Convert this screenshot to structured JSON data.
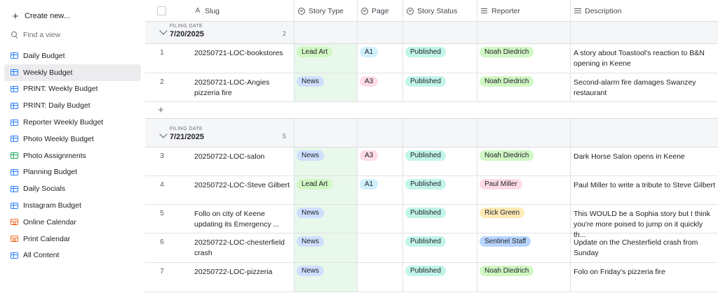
{
  "sidebar": {
    "create_label": "Create new...",
    "find_placeholder": "Find a view",
    "items": [
      {
        "label": "Daily Budget",
        "icon": "grid-view-icon",
        "active": false
      },
      {
        "label": "Weekly Budget",
        "icon": "grid-view-icon",
        "active": true
      },
      {
        "label": "PRINT: Weekly Budget",
        "icon": "grid-view-icon",
        "active": false
      },
      {
        "label": "PRINT: Daily Budget",
        "icon": "grid-view-icon",
        "active": false
      },
      {
        "label": "Reporter Weekly Budget",
        "icon": "grid-view-icon",
        "active": false
      },
      {
        "label": "Photo Weekly Budget",
        "icon": "grid-view-icon",
        "active": false
      },
      {
        "label": "Photo Assignments",
        "icon": "kanban-view-icon",
        "active": false
      },
      {
        "label": "Planning Budget",
        "icon": "grid-view-icon",
        "active": false
      },
      {
        "label": "Daily Socials",
        "icon": "grid-view-icon",
        "active": false
      },
      {
        "label": "Instagram Budget",
        "icon": "grid-view-icon",
        "active": false
      },
      {
        "label": "Online Calendar",
        "icon": "calendar-view-icon",
        "active": false
      },
      {
        "label": "Print Calendar",
        "icon": "calendar-view-icon",
        "active": false
      },
      {
        "label": "All Content",
        "icon": "grid-view-icon",
        "active": false
      }
    ]
  },
  "columns": {
    "slug": "Slug",
    "story_type": "Story Type",
    "page": "Page",
    "story_status": "Story Status",
    "reporter": "Reporter",
    "description": "Description"
  },
  "colors": {
    "lead_art": "#d1f7c4",
    "news": "#cfdfff",
    "page_a1": "#d0f0fd",
    "page_a3": "#ffdce5",
    "published": "#c2f5e9",
    "reporter_green": "#d1f7c4",
    "reporter_pink": "#ffdce5",
    "reporter_yellow": "#ffeab6",
    "reporter_blue": "#b8d5ff",
    "story_type_column_bg": "#e8f8ea"
  },
  "groups": [
    {
      "label": "FILING DATE",
      "value": "7/20/2025",
      "count": "2",
      "rows": [
        {
          "num": "1",
          "slug": "20250721-LOC-bookstores",
          "story_type": "Lead Art",
          "page": "A1",
          "status": "Published",
          "reporter": "Noah Diedrich",
          "description": "A story about Toastool's reaction to B&N opening in Keene"
        },
        {
          "num": "2",
          "slug": "20250721-LOC-Angies pizzeria fire",
          "story_type": "News",
          "page": "A3",
          "status": "Published",
          "reporter": "Noah Diedrich",
          "description": "Second-alarm fire damages Swanzey restaurant"
        }
      ]
    },
    {
      "label": "FILING DATE",
      "value": "7/21/2025",
      "count": "5",
      "rows": [
        {
          "num": "3",
          "slug": "20250722-LOC-salon",
          "story_type": "News",
          "page": "A3",
          "status": "Published",
          "reporter": "Noah Diedrich",
          "description": "Dark Horse Salon opens in Keene"
        },
        {
          "num": "4",
          "slug": "20250722-LOC-Steve Gilbert",
          "story_type": "Lead Art",
          "page": "A1",
          "status": "Published",
          "reporter": "Paul Miller",
          "description": "Paul Miller to write a tribute to Steve Gilbert"
        },
        {
          "num": "5",
          "slug": "Follo on city of Keene updating its Emergency ...",
          "story_type": "News",
          "page": "",
          "status": "Published",
          "reporter": "Rick Green",
          "description": "This WOULD be a Sophia story but I think you're more poised to jump on it quickly th..."
        },
        {
          "num": "6",
          "slug": "20250722-LOC-chesterfield crash",
          "story_type": "News",
          "page": "",
          "status": "Published",
          "reporter": "Sentinel Staff",
          "description": "Update on the Chesterfield crash from Sunday"
        },
        {
          "num": "7",
          "slug": "20250722-LOC-pizzeria",
          "story_type": "News",
          "page": "",
          "status": "Published",
          "reporter": "Noah Diedrich",
          "description": "Folo on Friday's pizzeria fire"
        }
      ]
    }
  ]
}
